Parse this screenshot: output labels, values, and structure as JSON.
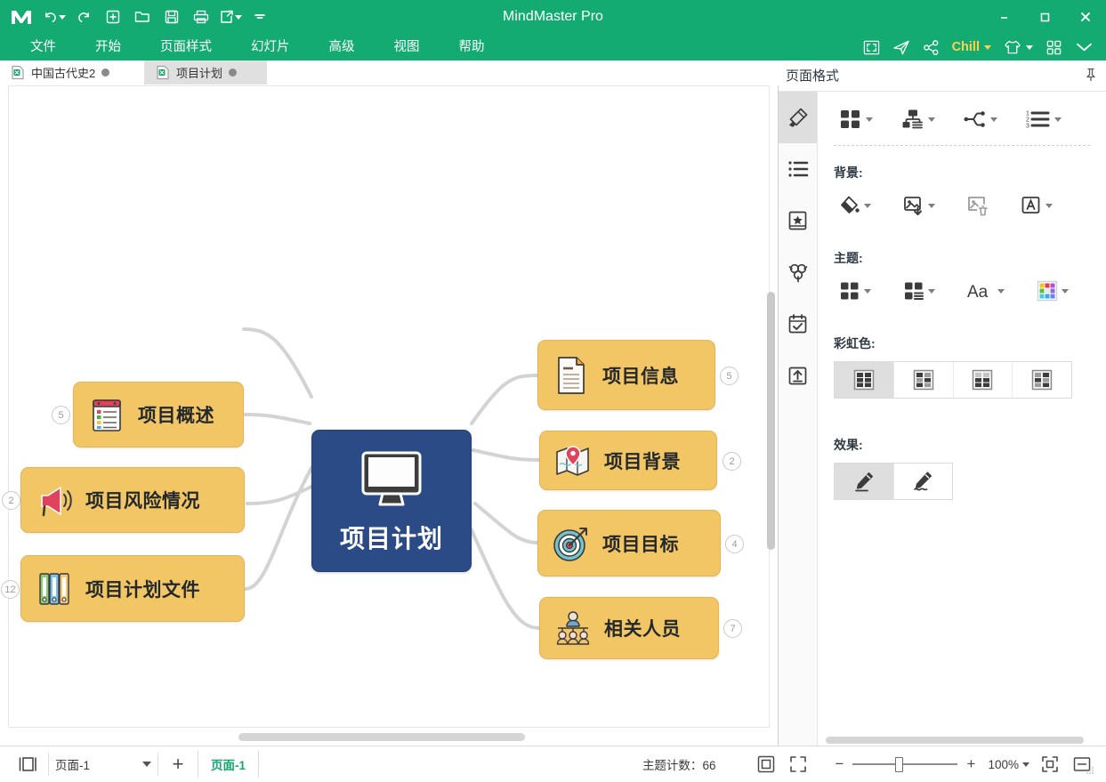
{
  "window": {
    "title": "MindMaster Pro",
    "logo_icon": "mindmaster-logo-icon",
    "minimize_label": "–",
    "maximize_label": "□",
    "close_label": "✕"
  },
  "quick_toolbar": [
    {
      "name": "undo-button",
      "icon": "undo-icon",
      "has_caret": true
    },
    {
      "name": "redo-button",
      "icon": "redo-icon",
      "has_caret": false
    },
    {
      "name": "new-button",
      "icon": "plus-box-icon",
      "has_caret": false
    },
    {
      "name": "open-button",
      "icon": "folder-icon",
      "has_caret": false
    },
    {
      "name": "save-button",
      "icon": "save-icon",
      "has_caret": false
    },
    {
      "name": "print-button",
      "icon": "print-icon",
      "has_caret": false
    },
    {
      "name": "export-button",
      "icon": "export-icon",
      "has_caret": true
    },
    {
      "name": "more-button",
      "icon": "chevron-down-icon",
      "has_caret": false
    }
  ],
  "menu": {
    "items": [
      {
        "label": "文件",
        "name": "menu-file"
      },
      {
        "label": "开始",
        "name": "menu-home"
      },
      {
        "label": "页面样式",
        "name": "menu-page-style"
      },
      {
        "label": "幻灯片",
        "name": "menu-slideshow"
      },
      {
        "label": "高级",
        "name": "menu-advanced"
      },
      {
        "label": "视图",
        "name": "menu-view"
      },
      {
        "label": "帮助",
        "name": "menu-help"
      }
    ],
    "right_tools": [
      {
        "name": "presentation-button",
        "icon": "fullscreen-frame-icon"
      },
      {
        "name": "send-button",
        "icon": "paper-plane-icon"
      },
      {
        "name": "share-button",
        "icon": "share-nodes-icon"
      },
      {
        "name": "account-button",
        "icon": "",
        "label": "Chill",
        "has_caret": true,
        "color": "#ffd24a"
      },
      {
        "name": "theme-skin-button",
        "icon": "tshirt-icon",
        "has_caret": true
      },
      {
        "name": "apps-button",
        "icon": "grid-apps-icon"
      },
      {
        "name": "collapse-ribbon-button",
        "icon": "chevron-double-down-icon"
      }
    ]
  },
  "tabs": [
    {
      "label": "中国古代史2",
      "name": "document-tab-1",
      "active": false,
      "icon": "document-icon"
    },
    {
      "label": "项目计划",
      "name": "document-tab-2",
      "active": true,
      "icon": "document-icon"
    }
  ],
  "mindmap": {
    "central": {
      "label": "项目计划",
      "icon": "monitor-icon",
      "color": "#2a4b85"
    },
    "node_color": "#f3c665",
    "left_nodes": [
      {
        "label": "项目概述",
        "icon": "checklist-icon",
        "badge": "5"
      },
      {
        "label": "项目风险情况",
        "icon": "megaphone-icon",
        "badge": "2"
      },
      {
        "label": "项目计划文件",
        "icon": "binders-icon",
        "badge": "12"
      }
    ],
    "right_nodes": [
      {
        "label": "项目信息",
        "icon": "file-document-icon",
        "badge": "5"
      },
      {
        "label": "项目背景",
        "icon": "map-pin-icon",
        "badge": "2"
      },
      {
        "label": "项目目标",
        "icon": "target-icon",
        "badge": "4"
      },
      {
        "label": "相关人员",
        "icon": "org-people-icon",
        "badge": "7"
      }
    ]
  },
  "right_panel": {
    "title": "页面格式",
    "pin_icon": "pin-icon",
    "rail": [
      {
        "name": "rail-style",
        "icon": "paint-bucket-icon",
        "active": true
      },
      {
        "name": "rail-outline",
        "icon": "bullet-list-icon",
        "active": false
      },
      {
        "name": "rail-clipart",
        "icon": "book-star-icon",
        "active": false
      },
      {
        "name": "rail-icons",
        "icon": "clover-icon",
        "active": false
      },
      {
        "name": "rail-tasks",
        "icon": "calendar-check-icon",
        "active": false
      },
      {
        "name": "rail-export",
        "icon": "upload-box-icon",
        "active": false
      }
    ],
    "layout_tools": [
      {
        "name": "map-layout-button",
        "icon": "grid-four-icon",
        "has_caret": true
      },
      {
        "name": "structure-button",
        "icon": "org-chart-icon",
        "has_caret": true
      },
      {
        "name": "branch-style-button",
        "icon": "branch-line-icon",
        "has_caret": true
      },
      {
        "name": "numbering-button",
        "icon": "numbered-list-icon",
        "has_caret": true
      }
    ],
    "background": {
      "label": "背景:",
      "tools": [
        {
          "name": "background-fill-button",
          "icon": "paint-fill-icon",
          "has_caret": true
        },
        {
          "name": "background-image-button",
          "icon": "image-add-icon",
          "has_caret": true
        },
        {
          "name": "background-image-delete-button",
          "icon": "image-delete-icon",
          "has_caret": false
        },
        {
          "name": "watermark-button",
          "icon": "watermark-a-icon",
          "has_caret": true
        }
      ]
    },
    "theme": {
      "label": "主题:",
      "tools": [
        {
          "name": "theme-gallery-button",
          "icon": "grid-four-icon",
          "has_caret": true
        },
        {
          "name": "theme-layout-button",
          "icon": "grid-list-icon",
          "has_caret": true
        },
        {
          "name": "theme-font-button",
          "icon": "font-aa-icon",
          "has_caret": true
        },
        {
          "name": "theme-color-button",
          "icon": "color-palette-icon",
          "has_caret": true
        }
      ]
    },
    "rainbow": {
      "label": "彩虹色:",
      "options": [
        {
          "name": "rainbow-option-1",
          "icon": "swatch-grid-icon",
          "selected": true
        },
        {
          "name": "rainbow-option-2",
          "icon": "swatch-grid-icon",
          "selected": false
        },
        {
          "name": "rainbow-option-3",
          "icon": "swatch-grid-icon",
          "selected": false
        },
        {
          "name": "rainbow-option-4",
          "icon": "swatch-grid-icon",
          "selected": false
        }
      ]
    },
    "effect": {
      "label": "效果:",
      "options": [
        {
          "name": "effect-straight",
          "icon": "pen-straight-icon",
          "selected": true
        },
        {
          "name": "effect-hand-drawn",
          "icon": "pen-wavy-icon",
          "selected": false
        }
      ]
    }
  },
  "statusbar": {
    "outline_icon": "panel-toggle-icon",
    "page_select_value": "页面-1",
    "add_page_label": "+",
    "page_tab_label": "页面-1",
    "topic_count_label": "主题计数：",
    "topic_count_value": "66",
    "fit_page_icon": "fit-page-icon",
    "fullscreen_icon": "fullscreen-icon",
    "zoom_minus": "−",
    "zoom_plus": "+",
    "zoom_value": "100%",
    "focus_icon": "focus-icon",
    "split-icon": "split-view-icon"
  }
}
